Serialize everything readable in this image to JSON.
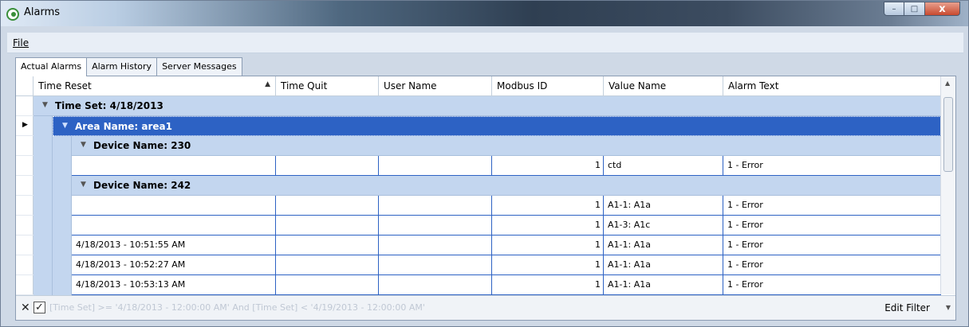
{
  "window": {
    "title": "Alarms",
    "buttons": {
      "minimize": "–",
      "maximize": "□",
      "close": "x"
    }
  },
  "menu": {
    "file": "File"
  },
  "tabs": [
    "Actual Alarms",
    "Alarm History",
    "Server Messages"
  ],
  "grid": {
    "columns": [
      "Time Reset",
      "Time Quit",
      "User Name",
      "Modbus ID",
      "Value Name",
      "Alarm Text"
    ],
    "sort_indicator": "▲",
    "groups": {
      "time_set": "Time Set: 4/18/2013",
      "area": "Area Name: area1",
      "device_230": "Device Name: 230",
      "device_242": "Device Name: 242"
    },
    "device_230_rows": [
      {
        "time_reset": "",
        "time_quit": "",
        "user": "",
        "modbus_id": "1",
        "value_name": "ctd",
        "alarm_text": "1 - Error"
      }
    ],
    "device_242_rows": [
      {
        "time_reset": "",
        "time_quit": "",
        "user": "",
        "modbus_id": "1",
        "value_name": "A1-1: A1a",
        "alarm_text": "1 - Error"
      },
      {
        "time_reset": "",
        "time_quit": "",
        "user": "",
        "modbus_id": "1",
        "value_name": "A1-3: A1c",
        "alarm_text": "1 - Error"
      },
      {
        "time_reset": "4/18/2013 - 10:51:55 AM",
        "time_quit": "",
        "user": "",
        "modbus_id": "1",
        "value_name": "A1-1: A1a",
        "alarm_text": "1 - Error"
      },
      {
        "time_reset": "4/18/2013 - 10:52:27 AM",
        "time_quit": "",
        "user": "",
        "modbus_id": "1",
        "value_name": "A1-1: A1a",
        "alarm_text": "1 - Error"
      },
      {
        "time_reset": "4/18/2013 - 10:53:13 AM",
        "time_quit": "",
        "user": "",
        "modbus_id": "1",
        "value_name": "A1-1: A1a",
        "alarm_text": "1 - Error"
      }
    ]
  },
  "filter": {
    "expression": "[Time Set] >= '4/18/2013 - 12:00:00 AM' And [Time Set] < '4/19/2013 - 12:00:00 AM'",
    "enabled_mark": "✓",
    "edit_label": "Edit Filter"
  },
  "colors": {
    "group_band": "#c3d6ef",
    "selected_row": "#2d62c4",
    "grid_line": "#2d62c4"
  }
}
